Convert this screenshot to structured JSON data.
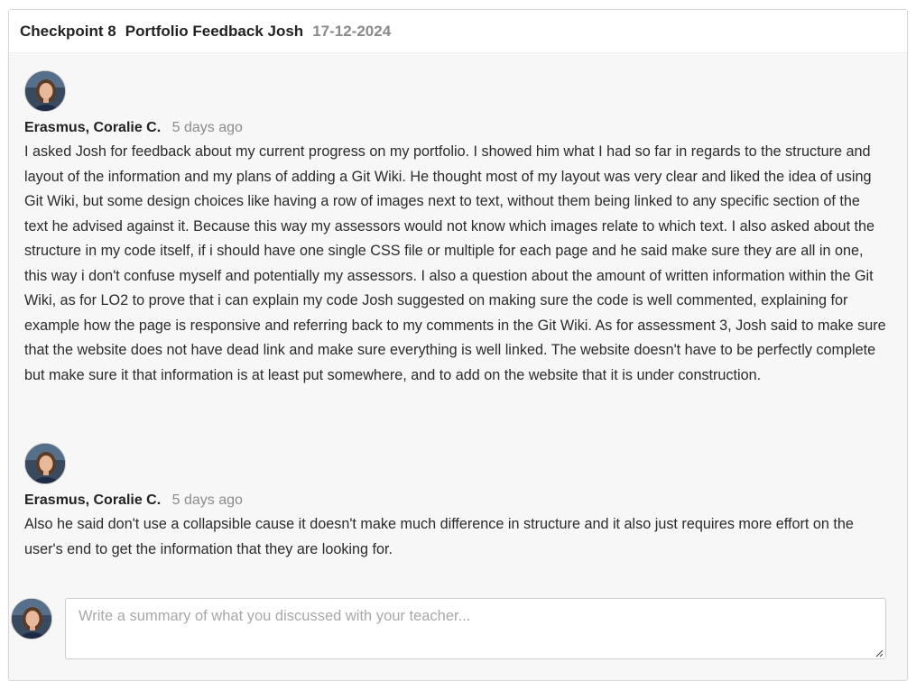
{
  "header": {
    "checkpoint": "Checkpoint 8",
    "title": "Portfolio Feedback Josh",
    "date": "17-12-2024"
  },
  "comments": [
    {
      "author": "Erasmus, Coralie C.",
      "time": "5 days ago",
      "text": "I asked Josh for feedback about my current progress on my portfolio. I showed him what I had so far in regards to the structure and layout of the information and my plans of adding a Git Wiki. He thought most of my layout was very clear and liked the idea of using Git Wiki, but some design choices like having a row of images next to text, without them being linked to any specific section of the text he advised against it. Because this way my assessors would not know which images relate to which text. I also asked about the structure in my code itself, if i should have one single CSS file or multiple for each page and he said make sure they are all in one, this way i don't confuse myself and potentially my assessors. I also a question about the amount of written information within the Git Wiki, as for LO2 to prove that i can explain my code Josh suggested on making sure the code is well commented, explaining for example how the page is responsive and referring back to my comments in the Git Wiki. As for assessment 3, Josh said to make sure that the website does not have dead link and make sure everything is well linked. The website doesn't have to be perfectly complete but make sure it that information is at least put somewhere, and to add on the website that it is under construction."
    },
    {
      "author": "Erasmus, Coralie C.",
      "time": "5 days ago",
      "text": "Also he said don't use a collapsible cause it doesn't make much difference in structure and it also just requires more effort on the user's end to get the information that they are looking for."
    }
  ],
  "reply": {
    "placeholder": "Write a summary of what you discussed with your teacher...",
    "value": ""
  },
  "icons": {
    "avatar": "user-avatar-photo",
    "resize": "textarea-resize-icon"
  }
}
